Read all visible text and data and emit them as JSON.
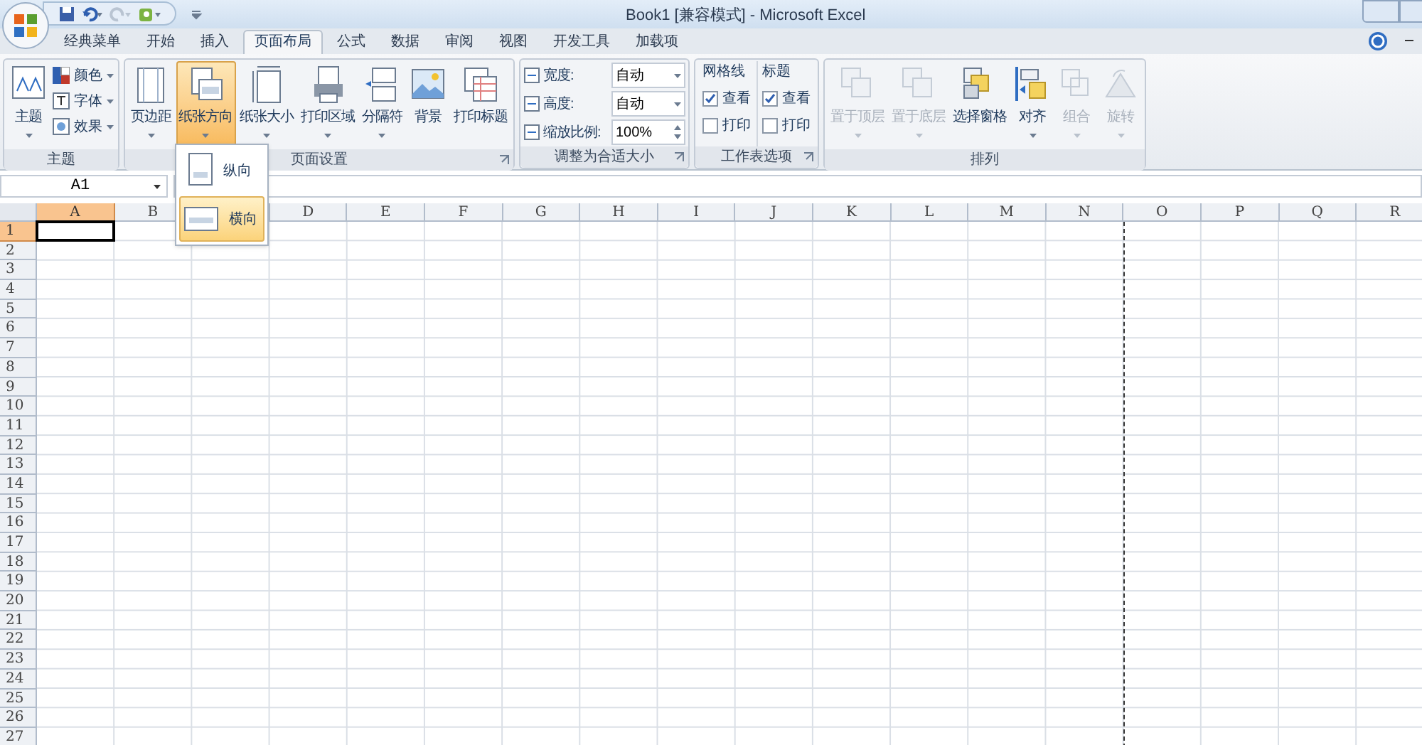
{
  "window": {
    "title": "Book1  [兼容模式] - Microsoft Excel"
  },
  "tabs": [
    {
      "label": "经典菜单",
      "selected": false
    },
    {
      "label": "开始",
      "selected": false
    },
    {
      "label": "插入",
      "selected": false
    },
    {
      "label": "页面布局",
      "selected": true
    },
    {
      "label": "公式",
      "selected": false
    },
    {
      "label": "数据",
      "selected": false
    },
    {
      "label": "审阅",
      "selected": false
    },
    {
      "label": "视图",
      "selected": false
    },
    {
      "label": "开发工具",
      "selected": false
    },
    {
      "label": "加载项",
      "selected": false
    }
  ],
  "ribbon": {
    "groups": [
      {
        "title": "主题",
        "launcher": false,
        "items": [
          {
            "kind": "large",
            "label": "主题",
            "dropdown": true,
            "disabled": false,
            "pressed": false
          },
          {
            "kind": "stack",
            "rows": [
              {
                "label": "颜色",
                "dropdown": true
              },
              {
                "label": "字体",
                "dropdown": true
              },
              {
                "label": "效果",
                "dropdown": true
              }
            ]
          }
        ]
      },
      {
        "title": "页面设置",
        "launcher": true,
        "items": [
          {
            "kind": "large",
            "label": "页边距",
            "dropdown": true,
            "disabled": false,
            "pressed": false
          },
          {
            "kind": "large",
            "label": "纸张方向",
            "dropdown": true,
            "disabled": false,
            "pressed": true
          },
          {
            "kind": "large",
            "label": "纸张大小",
            "dropdown": true,
            "disabled": false,
            "pressed": false
          },
          {
            "kind": "large",
            "label": "打印区域",
            "dropdown": true,
            "disabled": false,
            "pressed": false
          },
          {
            "kind": "large",
            "label": "分隔符",
            "dropdown": true,
            "disabled": false,
            "pressed": false
          },
          {
            "kind": "large",
            "label": "背景",
            "dropdown": false,
            "disabled": false,
            "pressed": false
          },
          {
            "kind": "large",
            "label": "打印标题",
            "dropdown": false,
            "disabled": false,
            "pressed": false
          }
        ]
      },
      {
        "title": "调整为合适大小",
        "launcher": true,
        "items": [
          {
            "kind": "fields",
            "rows": [
              {
                "kind": "combo",
                "label": "宽度:",
                "value": "自动"
              },
              {
                "kind": "combo",
                "label": "高度:",
                "value": "自动"
              },
              {
                "kind": "spin",
                "label": "缩放比例:",
                "value": "100%"
              }
            ]
          }
        ]
      },
      {
        "title": "工作表选项",
        "launcher": true,
        "items": [
          {
            "kind": "checks",
            "heading": "网格线",
            "rows": [
              {
                "label": "查看",
                "checked": true
              },
              {
                "label": "打印",
                "checked": false
              }
            ]
          },
          {
            "kind": "checks",
            "heading": "标题",
            "rows": [
              {
                "label": "查看",
                "checked": true
              },
              {
                "label": "打印",
                "checked": false
              }
            ]
          }
        ]
      },
      {
        "title": "排列",
        "launcher": false,
        "items": [
          {
            "kind": "large",
            "label": "置于顶层",
            "dropdown": true,
            "disabled": true,
            "pressed": false
          },
          {
            "kind": "large",
            "label": "置于底层",
            "dropdown": true,
            "disabled": true,
            "pressed": false
          },
          {
            "kind": "large",
            "label": "选择窗格",
            "dropdown": false,
            "disabled": false,
            "pressed": false
          },
          {
            "kind": "large",
            "label": "对齐",
            "dropdown": true,
            "disabled": false,
            "pressed": false
          },
          {
            "kind": "large",
            "label": "组合",
            "dropdown": true,
            "disabled": true,
            "pressed": false
          },
          {
            "kind": "large",
            "label": "旋转",
            "dropdown": true,
            "disabled": true,
            "pressed": false
          }
        ]
      }
    ]
  },
  "orientation_menu": {
    "items": [
      {
        "label": "纵向",
        "selected": false
      },
      {
        "label": "横向",
        "selected": true
      }
    ]
  },
  "name_box": {
    "value": "A1"
  },
  "sheet": {
    "columns": [
      {
        "label": "A",
        "selected": true
      },
      {
        "label": "B",
        "selected": false
      },
      {
        "selected": false
      },
      {
        "label": "D",
        "selected": false
      },
      {
        "label": "E",
        "selected": false
      },
      {
        "label": "F",
        "selected": false
      },
      {
        "label": "G",
        "selected": false
      },
      {
        "label": "H",
        "selected": false
      },
      {
        "label": "I",
        "selected": false
      },
      {
        "label": "J",
        "selected": false
      },
      {
        "label": "K",
        "selected": false
      },
      {
        "label": "L",
        "selected": false
      },
      {
        "label": "M",
        "selected": false
      },
      {
        "label": "N",
        "selected": false
      },
      {
        "label": "O",
        "selected": false
      },
      {
        "label": "P",
        "selected": false
      },
      {
        "label": "Q",
        "selected": false
      },
      {
        "label": "R",
        "selected": false
      }
    ],
    "rows": [
      {
        "label": "1",
        "selected": true
      },
      {
        "label": "2",
        "selected": false
      },
      {
        "label": "3",
        "selected": false
      },
      {
        "label": "4",
        "selected": false
      },
      {
        "label": "5",
        "selected": false
      },
      {
        "label": "6",
        "selected": false
      },
      {
        "label": "7",
        "selected": false
      },
      {
        "label": "8",
        "selected": false
      },
      {
        "label": "9",
        "selected": false
      },
      {
        "label": "10",
        "selected": false
      },
      {
        "label": "11",
        "selected": false
      },
      {
        "label": "12",
        "selected": false
      },
      {
        "label": "13",
        "selected": false
      },
      {
        "label": "14",
        "selected": false
      },
      {
        "label": "15",
        "selected": false
      },
      {
        "label": "16",
        "selected": false
      },
      {
        "label": "17",
        "selected": false
      },
      {
        "label": "18",
        "selected": false
      },
      {
        "label": "19",
        "selected": false
      },
      {
        "label": "20",
        "selected": false
      },
      {
        "label": "21",
        "selected": false
      },
      {
        "label": "22",
        "selected": false
      },
      {
        "label": "23",
        "selected": false
      },
      {
        "label": "24",
        "selected": false
      },
      {
        "label": "25",
        "selected": false
      },
      {
        "label": "26",
        "selected": false
      },
      {
        "label": "27",
        "selected": false
      }
    ]
  }
}
